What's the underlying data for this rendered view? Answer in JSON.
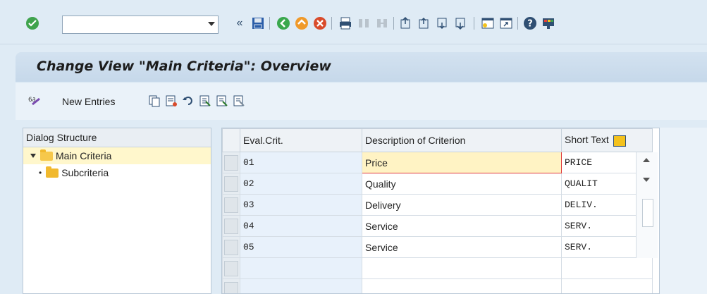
{
  "toolbar": {
    "command_field_value": "",
    "icons": [
      "check-icon",
      "back-icon",
      "save-icon",
      "nav-back-icon",
      "exit-icon",
      "cancel-icon",
      "print-icon",
      "find-icon",
      "find-next-icon",
      "first-page-icon",
      "prev-page-icon",
      "next-page-icon",
      "last-page-icon",
      "new-session-icon",
      "shortcut-icon",
      "help-icon",
      "layout-menu-icon"
    ]
  },
  "title": "Change View \"Main Criteria\": Overview",
  "app_toolbar": {
    "new_entries_label": "New Entries",
    "icons": [
      "display-change-icon",
      "copy-icon",
      "delete-icon",
      "undo-icon",
      "select-all-icon",
      "select-block-icon",
      "deselect-all-icon"
    ]
  },
  "dialog_structure": {
    "header": "Dialog Structure",
    "items": [
      {
        "label": "Main Criteria",
        "level": 0,
        "selected": true
      },
      {
        "label": "Subcriteria",
        "level": 1,
        "selected": false
      }
    ]
  },
  "table": {
    "columns": [
      "Eval.Crit.",
      "Description of Criterion",
      "Short Text"
    ],
    "rows": [
      {
        "crit": "01",
        "desc": "Price",
        "short": "PRICE"
      },
      {
        "crit": "02",
        "desc": "Quality",
        "short": "QUALIT"
      },
      {
        "crit": "03",
        "desc": "Delivery",
        "short": "DELIV."
      },
      {
        "crit": "04",
        "desc": "Service",
        "short": "SERV."
      },
      {
        "crit": "05",
        "desc": "Service",
        "short": "SERV."
      },
      {
        "crit": "",
        "desc": "",
        "short": ""
      },
      {
        "crit": "",
        "desc": "",
        "short": ""
      }
    ]
  }
}
